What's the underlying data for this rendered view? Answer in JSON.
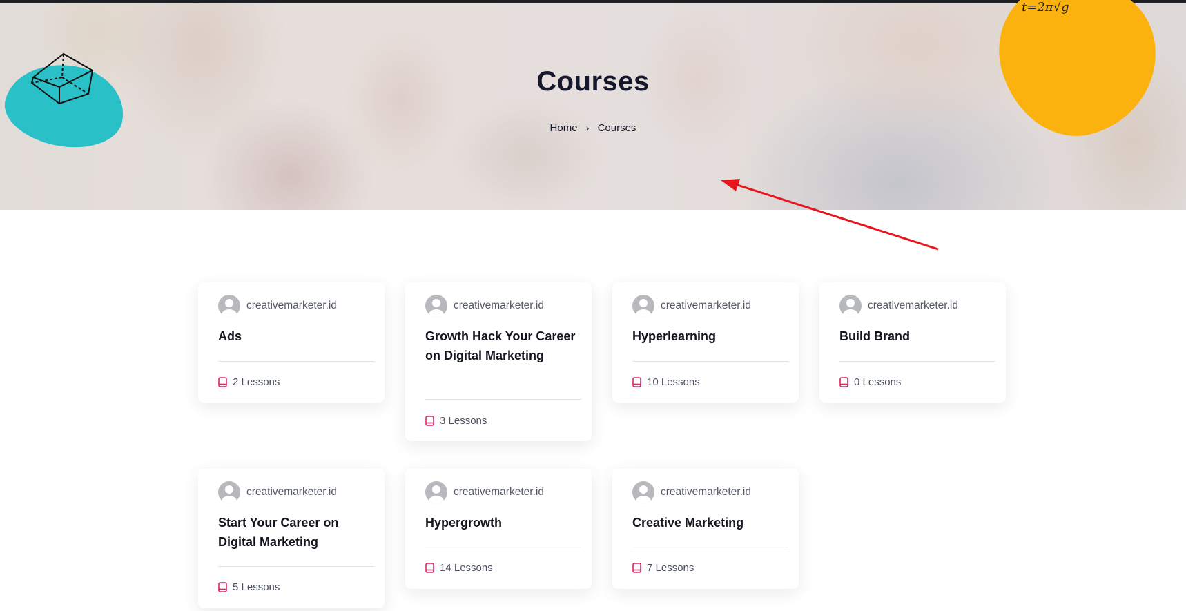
{
  "header": {
    "title": "Courses",
    "breadcrumb": {
      "home": "Home",
      "separator": "›",
      "current": "Courses"
    },
    "decorations": {
      "formula": "t=2π√g"
    }
  },
  "colors": {
    "accent_teal": "#29c0c8",
    "accent_yellow": "#fbb10e",
    "lesson_icon": "#e0245e",
    "annotation_arrow": "#e8141b"
  },
  "courses": [
    {
      "author": "creativemarketer.id",
      "title": "Ads",
      "lessons": "2 Lessons"
    },
    {
      "author": "creativemarketer.id",
      "title": "Growth Hack Your Career on Digital Marketing",
      "lessons": "3 Lessons"
    },
    {
      "author": "creativemarketer.id",
      "title": "Hyperlearning",
      "lessons": "10 Lessons"
    },
    {
      "author": "creativemarketer.id",
      "title": "Build Brand",
      "lessons": "0 Lessons"
    },
    {
      "author": "creativemarketer.id",
      "title": "Start Your Career on Digital Marketing",
      "lessons": "5 Lessons"
    },
    {
      "author": "creativemarketer.id",
      "title": "Hypergrowth",
      "lessons": "14 Lessons"
    },
    {
      "author": "creativemarketer.id",
      "title": "Creative Marketing",
      "lessons": "7 Lessons"
    }
  ],
  "icons": {
    "lesson": "book-icon",
    "author": "avatar-icon",
    "breadcrumb_separator": "chevron-right-icon"
  }
}
